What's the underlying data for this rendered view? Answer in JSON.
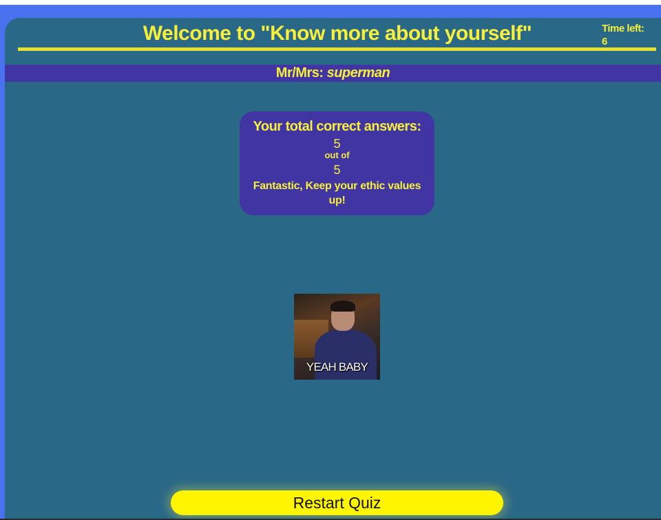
{
  "header": {
    "title": "Welcome to \"Know more about yourself\"",
    "timer_label": "Time left:",
    "timer_value": "6"
  },
  "user": {
    "label": "Mr/Mrs:",
    "name": "superman"
  },
  "score": {
    "heading": "Your total correct answers:",
    "correct": "5",
    "out_of_label": "out of",
    "total": "5",
    "message": "Fantastic, Keep your ethic values up!"
  },
  "gif": {
    "caption": "YEAH BABY"
  },
  "actions": {
    "restart_label": "Restart Quiz"
  },
  "colors": {
    "page_background": "#4a72f0",
    "panel_background": "#2a6887",
    "accent_purple": "#4035a3",
    "text_yellow": "#f7ef3a",
    "button_yellow": "#fff500"
  }
}
